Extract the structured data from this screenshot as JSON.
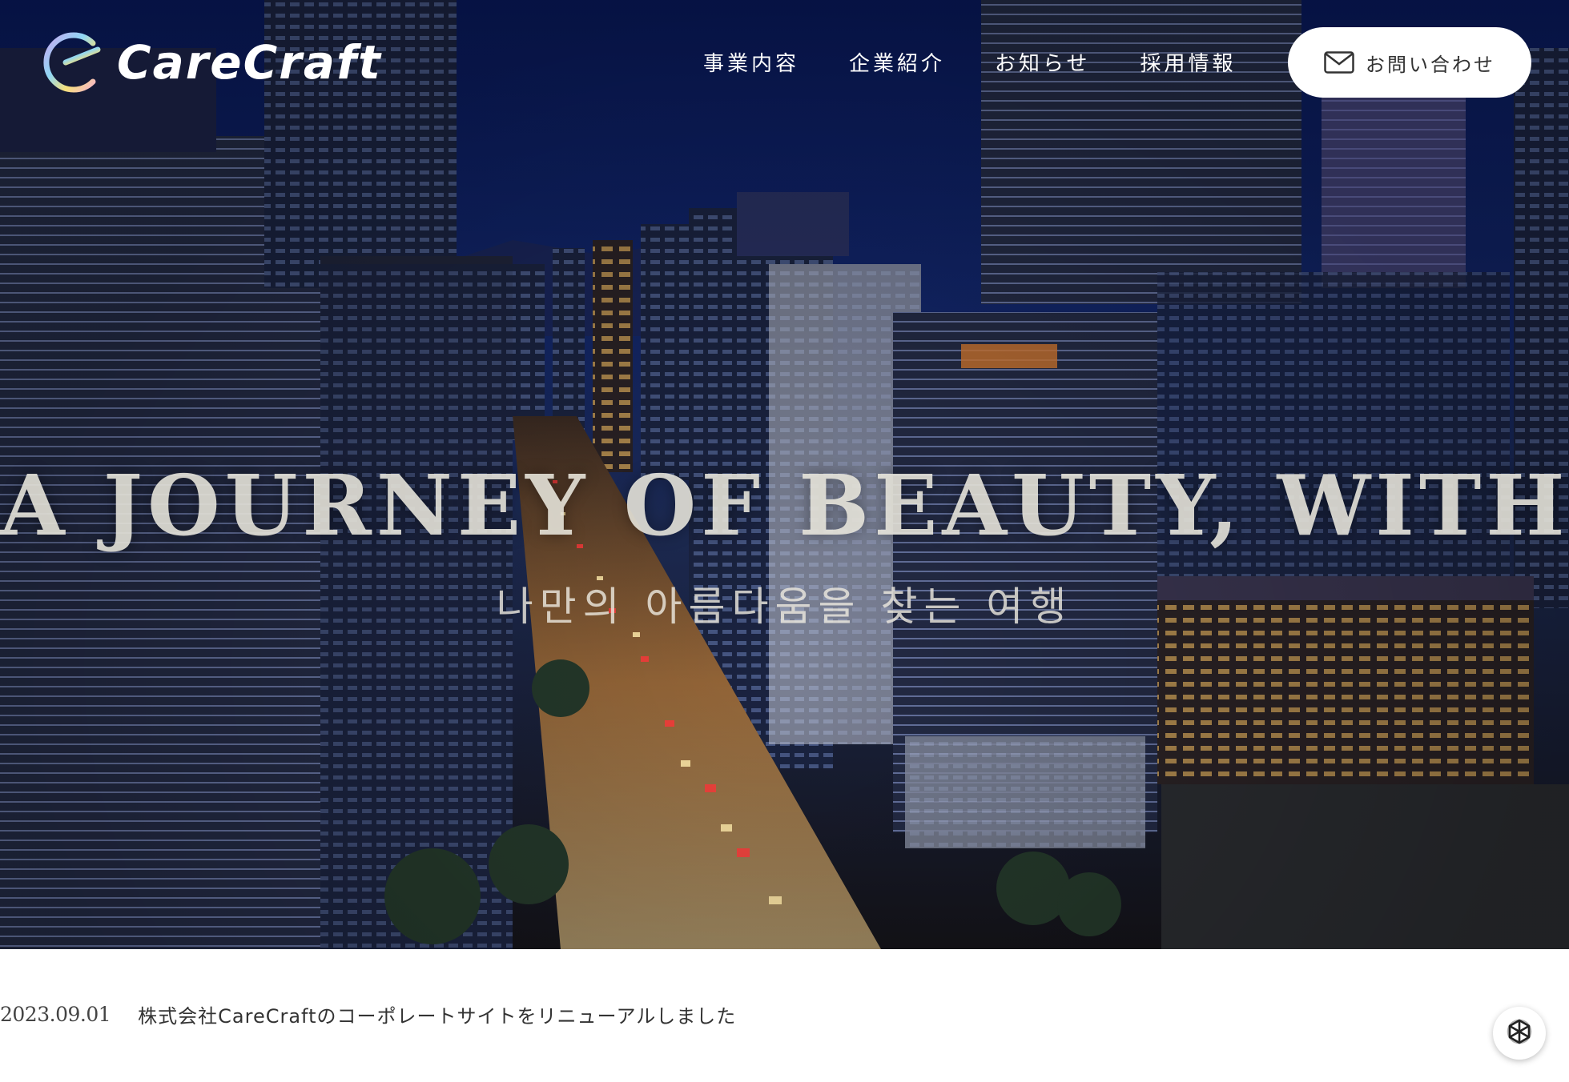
{
  "brand": {
    "name": "CareCraft"
  },
  "nav": {
    "items": [
      {
        "label": "事業内容"
      },
      {
        "label": "企業紹介"
      },
      {
        "label": "お知らせ"
      },
      {
        "label": "採用情報"
      }
    ],
    "contact_label": "お問い合わせ"
  },
  "hero": {
    "title": "A JOURNEY OF BEAUTY, WITH US.",
    "subtitle": "나만의 아름다움을 찾는 여행"
  },
  "news": {
    "items": [
      {
        "date": "2023.09.01",
        "title": "株式会社CareCraftのコーポレートサイトをリニューアルしました"
      }
    ]
  },
  "icons": {
    "logo": "carecraft-logo-icon",
    "mail": "mail-icon",
    "chat": "chat-assistant-icon"
  },
  "colors": {
    "background": "#ffffff",
    "hero_sky": "#0a1a4a",
    "nav_text": "#ffffff",
    "contact_button_bg": "#ffffff",
    "contact_button_text": "#333333",
    "body_text": "#333333"
  }
}
